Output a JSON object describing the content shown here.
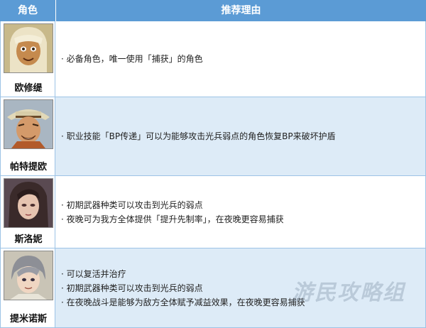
{
  "header": {
    "role_label": "角色",
    "reason_label": "推荐理由"
  },
  "colors": {
    "header_bg": "#5b9bd5",
    "alt_row_bg": "#ddebf7",
    "border": "#9dc3e6"
  },
  "rows": [
    {
      "name": "欧修缇",
      "reasons": [
        "· 必备角色，唯一使用「捕获」的角色"
      ]
    },
    {
      "name": "帕特提欧",
      "reasons": [
        "· 职业技能「BP传递」可以为能够攻击光兵弱点的角色恢复BP来破坏护盾"
      ]
    },
    {
      "name": "斯洛妮",
      "reasons": [
        "· 初期武器种类可以攻击到光兵的弱点",
        "· 夜晚可为我方全体提供「提升先制率」，在夜晚更容易捕获"
      ]
    },
    {
      "name": "提米诺斯",
      "reasons": [
        "· 可以复活并治疗",
        "· 初期武器种类可以攻击到光兵的弱点",
        "· 在夜晚战斗是能够为敌方全体赋予减益效果，在夜晚更容易捕获"
      ]
    }
  ],
  "watermark": "游民攻略组"
}
